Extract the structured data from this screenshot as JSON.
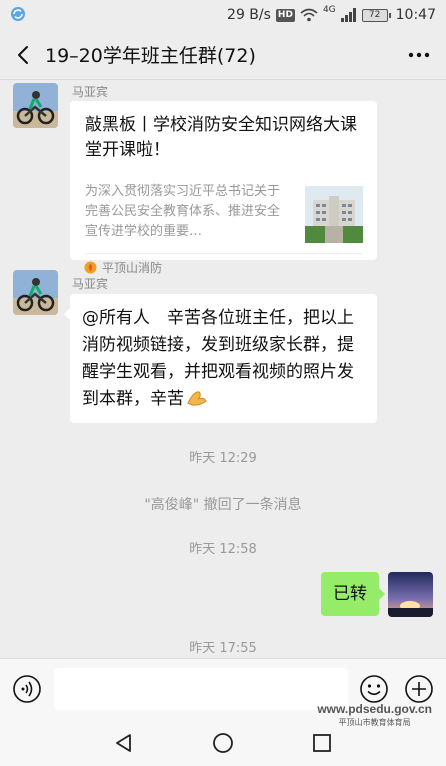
{
  "status_bar": {
    "app_icon": "sync-app-icon",
    "speed": "29 B/s",
    "hd": "HD",
    "network": "4G",
    "battery": "72",
    "time": "10:47"
  },
  "header": {
    "title": "19–20学年班主任群(72)",
    "back_icon": "chevron-left-icon",
    "more_icon": "more-dots-icon"
  },
  "messages": [
    {
      "type": "article",
      "sender": "马亚宾",
      "title": "敲黑板丨学校消防安全知识网络大课堂开课啦！",
      "desc": "为深入贯彻落实习近平总书记关于完善公民安全教育体系、推进安全宣传进学校的重要…",
      "source": "平顶山消防",
      "source_icon": "fire-department-icon"
    },
    {
      "type": "text",
      "sender": "马亚宾",
      "text": "@所有人　辛苦各位班主任，把以上消防视频链接，发到班级家长群，提醒学生观看，并把观看视频的照片发到本群，辛苦",
      "emoji": "folded-hands-emoji"
    },
    {
      "type": "time",
      "text": "昨天 12:29"
    },
    {
      "type": "system",
      "text": "\"高俊峰\" 撤回了一条消息"
    },
    {
      "type": "time",
      "text": "昨天 12:58"
    },
    {
      "type": "self_text",
      "text": "已转"
    },
    {
      "type": "time",
      "text": "昨天 17:55"
    }
  ],
  "input_bar": {
    "voice_icon": "voice-input-icon",
    "emoji_icon": "emoji-icon",
    "plus_icon": "plus-icon",
    "placeholder": ""
  },
  "watermark": {
    "url": "www.pdsedu.gov.cn",
    "org": "平顶山市教育体育局"
  },
  "nav": {
    "back": "nav-back-icon",
    "home": "nav-home-icon",
    "recents": "nav-recents-icon"
  },
  "colors": {
    "background": "#ededed",
    "self_bubble": "#95ec69",
    "other_bubble": "#ffffff",
    "meta_text": "#999999"
  }
}
